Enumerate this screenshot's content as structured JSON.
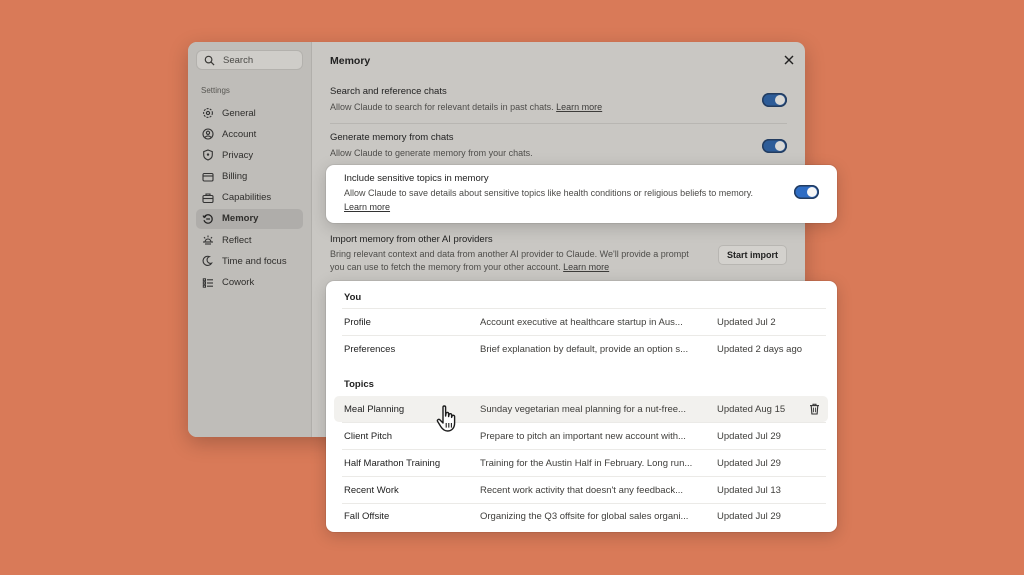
{
  "sidebar": {
    "search_placeholder": "Search",
    "section_label": "Settings",
    "items": [
      {
        "label": "General",
        "icon": "gear-icon"
      },
      {
        "label": "Account",
        "icon": "user-circle-icon"
      },
      {
        "label": "Privacy",
        "icon": "shield-icon"
      },
      {
        "label": "Billing",
        "icon": "card-icon"
      },
      {
        "label": "Capabilities",
        "icon": "briefcase-icon"
      },
      {
        "label": "Memory",
        "icon": "memory-icon",
        "active": true
      },
      {
        "label": "Reflect",
        "icon": "sun-icon"
      },
      {
        "label": "Time and focus",
        "icon": "clock-icon"
      },
      {
        "label": "Cowork",
        "icon": "list-icon"
      }
    ]
  },
  "panel": {
    "title": "Memory",
    "settings": {
      "search_chats": {
        "title": "Search and reference chats",
        "desc": "Allow Claude to search for relevant details in past chats.",
        "link": "Learn more",
        "enabled": true
      },
      "generate_memory": {
        "title": "Generate memory from chats",
        "desc": "Allow Claude to generate memory from your chats.",
        "enabled": true
      },
      "sensitive_topics": {
        "title": "Include sensitive topics in memory",
        "desc": "Allow Claude to save details about sensitive topics like health conditions or religious beliefs to memory.",
        "link": "Learn more",
        "enabled": true
      },
      "import": {
        "title": "Import memory from other AI providers",
        "desc": "Bring relevant context and data from another AI provider to Claude. We'll provide a prompt you can use to fetch the memory from your other account.",
        "link": "Learn more",
        "button": "Start import"
      }
    }
  },
  "memory": {
    "you_label": "You",
    "you": [
      {
        "name": "Profile",
        "desc": "Account executive  at healthcare startup in Aus...",
        "updated": "Updated Jul 2"
      },
      {
        "name": "Preferences",
        "desc": "Brief explanation by default, provide an option s...",
        "updated": "Updated 2 days ago"
      }
    ],
    "topics_label": "Topics",
    "topics": [
      {
        "name": "Meal Planning",
        "desc": "Sunday vegetarian meal planning for a nut-free...",
        "updated": "Updated Aug 15",
        "hover": true
      },
      {
        "name": "Client Pitch",
        "desc": "Prepare to pitch an important new account with...",
        "updated": "Updated Jul 29"
      },
      {
        "name": "Half Marathon Training",
        "desc": "Training for the Austin Half in February. Long run...",
        "updated": "Updated Jul 29"
      },
      {
        "name": "Recent Work",
        "desc": "Recent work activity that doesn't any feedback...",
        "updated": "Updated Jul 13"
      },
      {
        "name": "Fall Offsite",
        "desc": "Organizing the Q3 offsite for global sales organi...",
        "updated": "Updated Jul 29"
      }
    ]
  },
  "colors": {
    "background": "#d97a58",
    "toggle_on": "#2f6dc4"
  }
}
